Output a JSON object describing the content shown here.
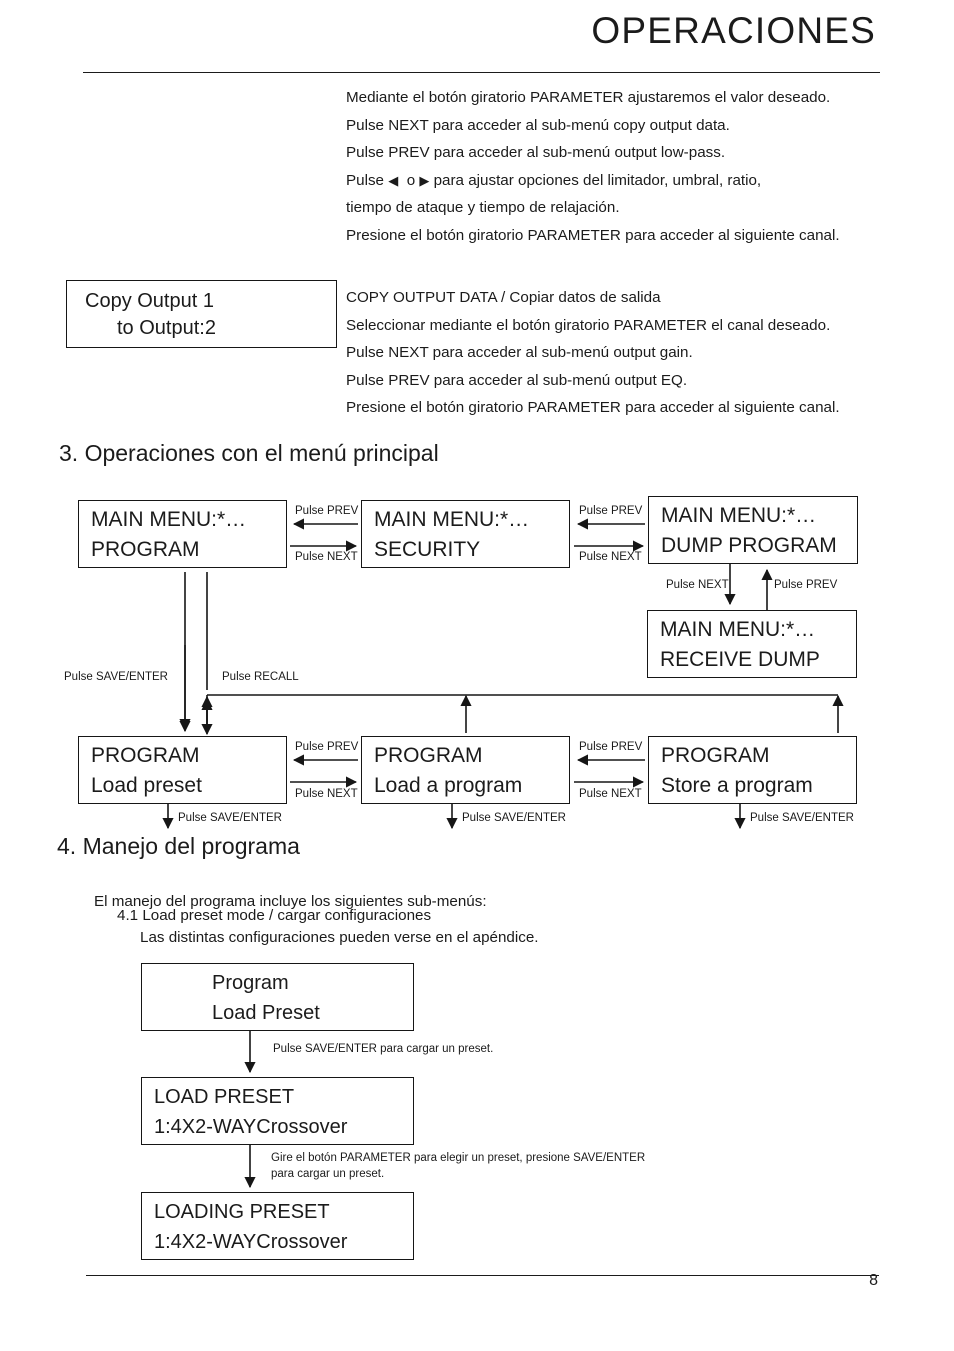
{
  "header": {
    "title": "OPERACIONES",
    "page_number": "8"
  },
  "intro_paragraph": {
    "lines": [
      "Mediante el botón giratorio PARAMETER ajustaremos el valor deseado.",
      "Pulse NEXT para acceder al sub-menú copy output data.",
      "Pulse PREV para acceder al sub-menú output low-pass.",
      "tiempo de ataque y tiempo de relajación.",
      "Presione el botón giratorio PARAMETER para acceder al siguiente canal."
    ],
    "line4_prefix": "Pulse",
    "line4_left_arrow": "◀",
    "line4_or": "o",
    "line4_right_arrow": "▶",
    "line4_suffix": "para ajustar opciones del limitador, umbral, ratio,"
  },
  "copy_output": {
    "box": {
      "line1": "Copy Output 1",
      "line2": "to Output:2"
    },
    "lines": [
      "COPY OUTPUT DATA / Copiar datos de salida",
      "Seleccionar mediante el botón giratorio PARAMETER el canal deseado.",
      "Pulse NEXT para acceder al sub-menú output gain.",
      "Pulse PREV para acceder al sub-menú output EQ.",
      "Presione el botón giratorio PARAMETER para acceder al siguiente canal."
    ]
  },
  "section3": {
    "heading": "3. Operaciones con el menú principal",
    "boxes": {
      "program": {
        "line1": "MAIN MENU:*…",
        "line2": "PROGRAM"
      },
      "security": {
        "line1": "MAIN MENU:*…",
        "line2": "SECURITY"
      },
      "dump": {
        "line1": "MAIN MENU:*…",
        "line2": "DUMP PROGRAM"
      },
      "receive": {
        "line1": "MAIN MENU:*…",
        "line2": "RECEIVE DUMP"
      },
      "load_preset": {
        "line1": "PROGRAM",
        "line2": "Load preset"
      },
      "load_program": {
        "line1": "PROGRAM",
        "line2": "Load a program"
      },
      "store_program": {
        "line1": "PROGRAM",
        "line2": "Store a program"
      }
    },
    "labels": {
      "prev_1": "Pulse PREV",
      "next_1": "Pulse NEXT",
      "prev_2": "Pulse PREV",
      "next_2": "Pulse NEXT",
      "next_dump": "Pulse NEXT",
      "prev_dump": "Pulse PREV",
      "save_enter_left": "Pulse SAVE/ENTER",
      "recall": "Pulse RECALL",
      "prev_3": "Pulse PREV",
      "next_3": "Pulse NEXT",
      "prev_4": "Pulse PREV",
      "next_4": "Pulse NEXT",
      "save_enter_1": "Pulse SAVE/ENTER",
      "save_enter_2": "Pulse SAVE/ENTER",
      "save_enter_3": "Pulse SAVE/ENTER"
    }
  },
  "section4": {
    "heading": "4. Manejo del programa",
    "intro": "El manejo del programa incluye los siguientes sub-menús:",
    "sub_heading": "4.1 Load preset mode / cargar configuraciones",
    "sub_text": "Las distintas configuraciones pueden verse en el apéndice.",
    "boxes": {
      "program_load_preset": {
        "line1": "Program",
        "line2": "Load Preset"
      },
      "load_preset": {
        "line1": "LOAD PRESET",
        "line2": "1:4X2-WAYCrossover"
      },
      "loading_preset": {
        "line1": "LOADING PRESET",
        "line2": "1:4X2-WAYCrossover"
      }
    },
    "labels": {
      "step1": "Pulse SAVE/ENTER para cargar un preset.",
      "step2_line1": "Gire el botón PARAMETER para elegir un preset, presione SAVE/ENTER",
      "step2_line2": "para cargar un preset."
    }
  }
}
